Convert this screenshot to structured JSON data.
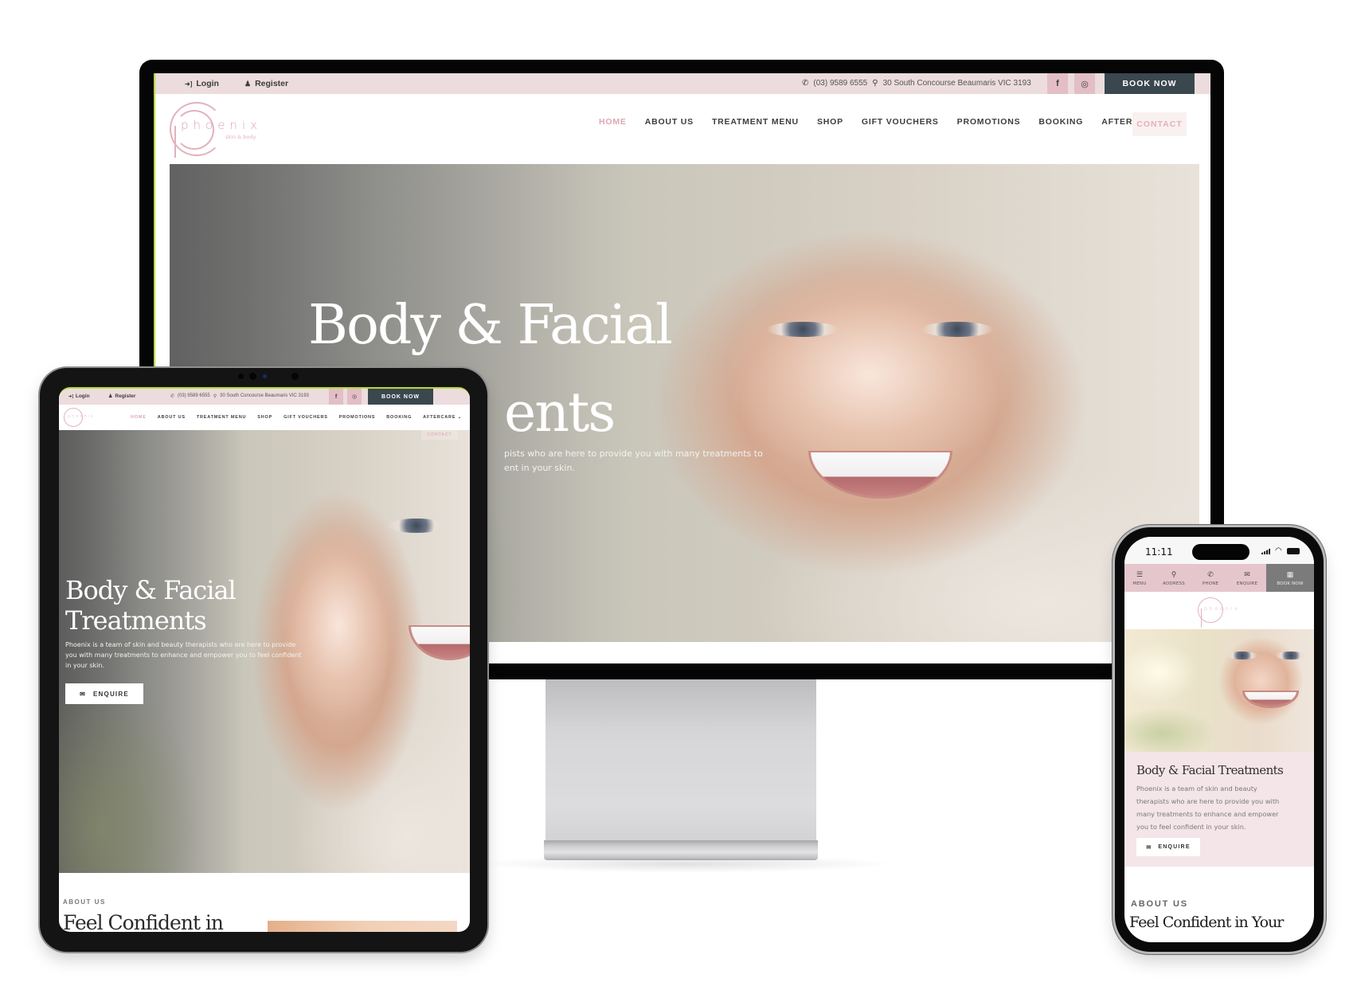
{
  "site": {
    "topbar": {
      "login": "Login",
      "register": "Register",
      "phone": "(03) 9589 6555",
      "address": "30 South Concourse Beaumaris VIC 3193",
      "social": [
        {
          "name": "facebook",
          "glyph": "f"
        },
        {
          "name": "instagram",
          "glyph": "◎"
        }
      ],
      "book_now": "BOOK NOW",
      "icons": {
        "login": "➜]",
        "register": "♟",
        "phone": "✆",
        "pin": "⚲"
      }
    },
    "logo": {
      "word": "phoenix",
      "tagline": "skin & body"
    },
    "nav": {
      "items": [
        {
          "label": "HOME",
          "active": true
        },
        {
          "label": "ABOUT US"
        },
        {
          "label": "TREATMENT MENU"
        },
        {
          "label": "SHOP"
        },
        {
          "label": "GIFT VOUCHERS"
        },
        {
          "label": "PROMOTIONS"
        },
        {
          "label": "BOOKING"
        },
        {
          "label": "AFTERCARE"
        }
      ],
      "dropdown_glyph": "⌄",
      "contact": "CONTACT"
    },
    "hero": {
      "title_line1": "Body & Facial",
      "title_line2": "Treatments",
      "title_full": "Body & Facial Treatments",
      "monitor_fragment_line2": "ents",
      "monitor_text_line1": "pists who are here to provide you with many treatments to",
      "monitor_text_line2": "ent in your skin.",
      "text": "Phoenix is a team of skin and beauty therapists who are here to provide you with many treatments to enhance and empower you to feel confident in your skin.",
      "enquire": "ENQUIRE",
      "enquire_icon": "✉"
    },
    "about": {
      "label": "ABOUT US",
      "tablet_heading": "Feel Confident in",
      "phone_heading": "Feel Confident in Your"
    }
  },
  "phone": {
    "time": "11:11",
    "mobile_nav": [
      {
        "label": "MENU",
        "icon": "☰"
      },
      {
        "label": "ADDRESS",
        "icon": "⚲"
      },
      {
        "label": "PHONE",
        "icon": "✆"
      },
      {
        "label": "ENQUIRE",
        "icon": "✉"
      },
      {
        "label": "BOOK NOW",
        "icon": "▦"
      }
    ]
  },
  "colors": {
    "topbar_bg": "#ecdcdd",
    "social_bg": "#e3bec6",
    "book_now_bg": "#3a474f",
    "accent_pink": "#dba7b3",
    "phone_hero_bg": "#f4e5e8"
  }
}
